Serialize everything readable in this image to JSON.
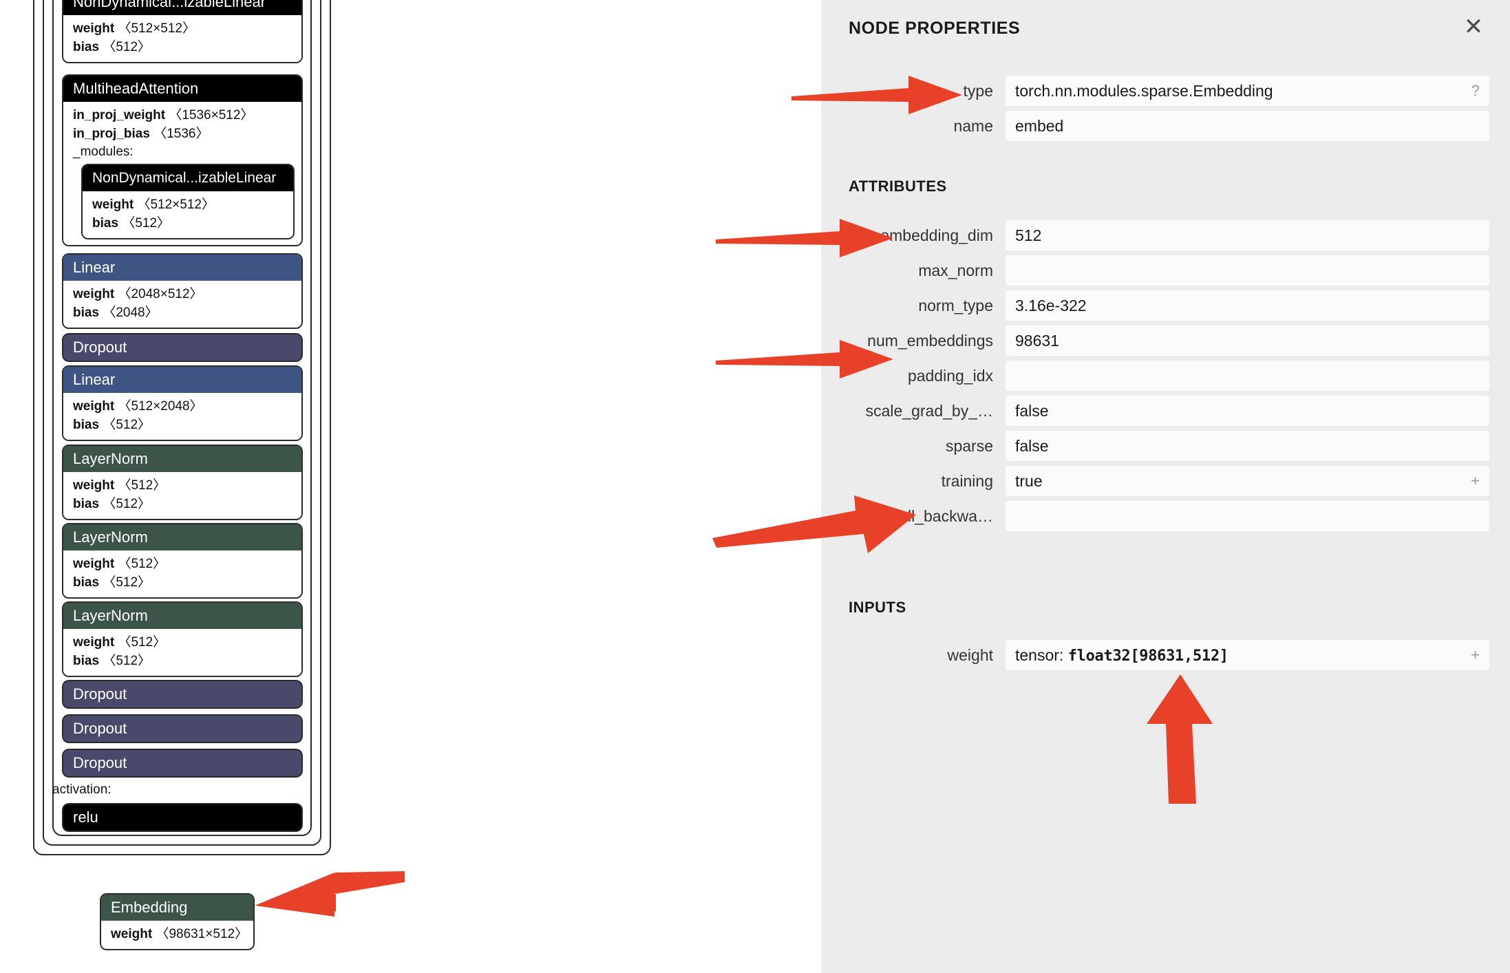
{
  "colors": {
    "arrow": "#e8412a",
    "header_black": "#000000",
    "header_blue": "#3e5584",
    "header_purple": "#494a6b",
    "header_green": "#3d5449",
    "sidebar_bg": "#ececec",
    "field_bg": "#fbfbfb"
  },
  "graph": {
    "nodes": [
      {
        "id": "node-nondyn-top",
        "title": "NonDynamical...izableLinear",
        "header_style": "hdr-black",
        "attrs": [
          {
            "name": "weight",
            "dim": "〈512×512〉"
          },
          {
            "name": "bias",
            "dim": "〈512〉"
          }
        ]
      },
      {
        "id": "node-multihead-attention",
        "title": "MultiheadAttention",
        "header_style": "hdr-black",
        "attrs": [
          {
            "name": "in_proj_weight",
            "dim": "〈1536×512〉"
          },
          {
            "name": "in_proj_bias",
            "dim": "〈1536〉"
          }
        ],
        "modules_label": "_modules:",
        "child": {
          "id": "node-nondyn-child",
          "title": "NonDynamical...izableLinear",
          "header_style": "hdr-black",
          "attrs": [
            {
              "name": "weight",
              "dim": "〈512×512〉"
            },
            {
              "name": "bias",
              "dim": "〈512〉"
            }
          ]
        }
      },
      {
        "id": "node-linear-1",
        "title": "Linear",
        "header_style": "hdr-blue",
        "attrs": [
          {
            "name": "weight",
            "dim": "〈2048×512〉"
          },
          {
            "name": "bias",
            "dim": "〈2048〉"
          }
        ]
      },
      {
        "id": "node-dropout-1",
        "title": "Dropout",
        "header_style": "hdr-purple",
        "attrs": []
      },
      {
        "id": "node-linear-2",
        "title": "Linear",
        "header_style": "hdr-blue",
        "attrs": [
          {
            "name": "weight",
            "dim": "〈512×2048〉"
          },
          {
            "name": "bias",
            "dim": "〈512〉"
          }
        ]
      },
      {
        "id": "node-layernorm-1",
        "title": "LayerNorm",
        "header_style": "hdr-green",
        "attrs": [
          {
            "name": "weight",
            "dim": "〈512〉"
          },
          {
            "name": "bias",
            "dim": "〈512〉"
          }
        ]
      },
      {
        "id": "node-layernorm-2",
        "title": "LayerNorm",
        "header_style": "hdr-green",
        "attrs": [
          {
            "name": "weight",
            "dim": "〈512〉"
          },
          {
            "name": "bias",
            "dim": "〈512〉"
          }
        ]
      },
      {
        "id": "node-layernorm-3",
        "title": "LayerNorm",
        "header_style": "hdr-green",
        "attrs": [
          {
            "name": "weight",
            "dim": "〈512〉"
          },
          {
            "name": "bias",
            "dim": "〈512〉"
          }
        ]
      },
      {
        "id": "node-dropout-2",
        "title": "Dropout",
        "header_style": "hdr-purple",
        "attrs": []
      },
      {
        "id": "node-dropout-3",
        "title": "Dropout",
        "header_style": "hdr-purple",
        "attrs": []
      },
      {
        "id": "node-dropout-4",
        "title": "Dropout",
        "header_style": "hdr-purple",
        "attrs": []
      }
    ],
    "activation_label": "activation:",
    "activation_value": "relu",
    "embedding_node": {
      "id": "node-embedding",
      "title": "Embedding",
      "header_style": "hdr-green",
      "attrs": [
        {
          "name": "weight",
          "dim": "〈98631×512〉"
        }
      ]
    }
  },
  "sidebar": {
    "title": "NODE PROPERTIES",
    "close_label": "✕",
    "properties": [
      {
        "label": "type",
        "value": "torch.nn.modules.sparse.Embedding",
        "adorn": "?"
      },
      {
        "label": "name",
        "value": "embed",
        "adorn": ""
      }
    ],
    "attributes_head": "ATTRIBUTES",
    "attributes": [
      {
        "label": "embedding_dim",
        "value": "512",
        "adorn": ""
      },
      {
        "label": "max_norm",
        "value": "",
        "adorn": ""
      },
      {
        "label": "norm_type",
        "value": "3.16e-322",
        "adorn": ""
      },
      {
        "label": "num_embeddings",
        "value": "98631",
        "adorn": ""
      },
      {
        "label": "padding_idx",
        "value": "",
        "adorn": ""
      },
      {
        "label": "scale_grad_by_…",
        "value": "false",
        "adorn": ""
      },
      {
        "label": "sparse",
        "value": "false",
        "adorn": ""
      },
      {
        "label": "training",
        "value": "true",
        "adorn": "+"
      },
      {
        "label": "_is_full_backwa…",
        "value": "",
        "adorn": ""
      }
    ],
    "inputs_head": "INPUTS",
    "inputs": [
      {
        "label": "weight",
        "value_prefix": "tensor: ",
        "value_mono": "float32[98631,512]",
        "adorn": "+"
      }
    ]
  },
  "annotations": {
    "arrows": [
      {
        "name": "arrow-to-type",
        "target": "type"
      },
      {
        "name": "arrow-to-embedding-dim",
        "target": "embedding_dim"
      },
      {
        "name": "arrow-to-num-embeddings",
        "target": "num_embeddings"
      },
      {
        "name": "arrow-to-training",
        "target": "training"
      },
      {
        "name": "arrow-to-weight-input",
        "target": "weight"
      },
      {
        "name": "arrow-to-embedding-node",
        "target": "Embedding"
      }
    ]
  }
}
